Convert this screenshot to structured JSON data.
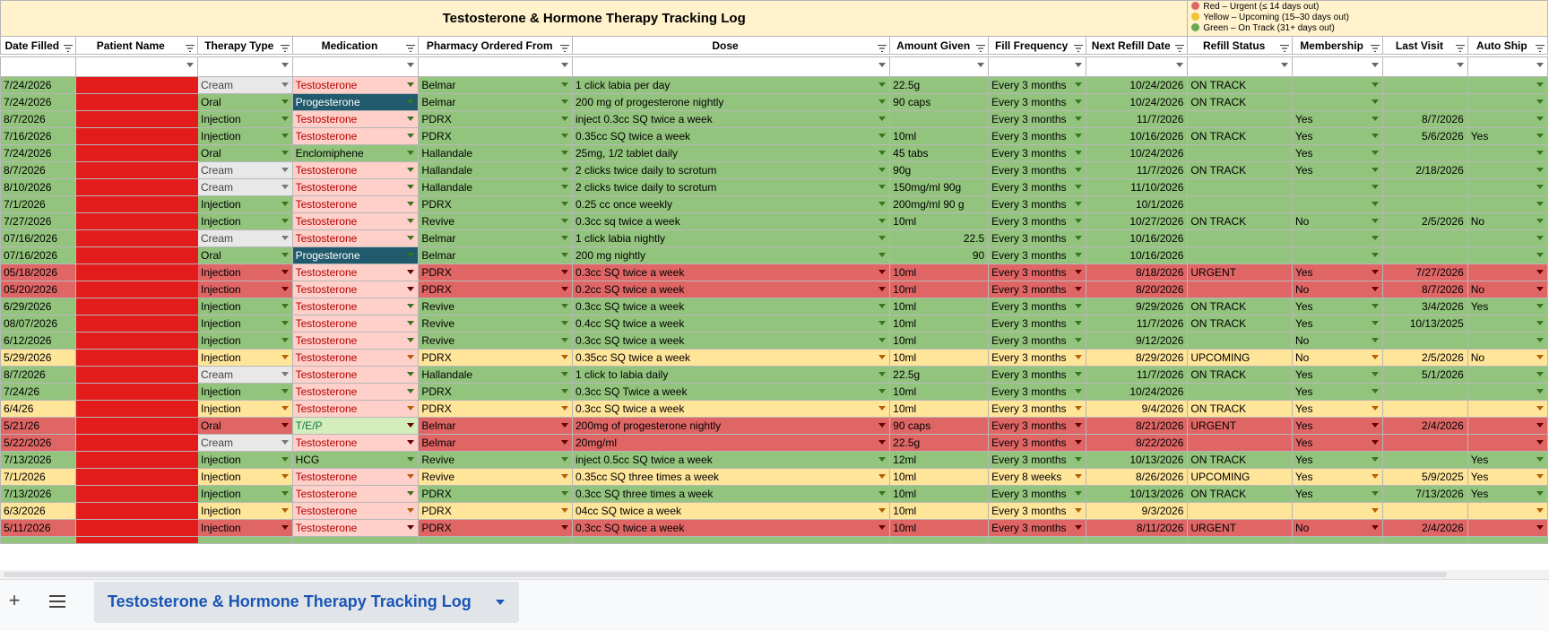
{
  "sheet_title": "Testosterone & Hormone Therapy Tracking Log",
  "legend": [
    {
      "label": "Red – Urgent (≤ 14 days out)",
      "color": "#e06666"
    },
    {
      "label": "Yellow – Upcoming (15–30 days out)",
      "color": "#f1c232"
    },
    {
      "label": "Green – On Track (31+ days out)",
      "color": "#6aa84f"
    }
  ],
  "colors": {
    "green": "#93c47d",
    "red": "#e06666",
    "yellow": "#ffe599",
    "header_bg": "#fff2cc",
    "tab_text": "#1a56b5"
  },
  "columns": [
    "Date Filled",
    "Patient Name",
    "Therapy Type",
    "Medication",
    "Pharmacy Ordered From",
    "Dose",
    "Amount Given",
    "Fill Frequency",
    "Next Refill Date",
    "Refill Status",
    "Membership",
    "Last Visit",
    "Auto Ship"
  ],
  "rows": [
    {
      "color": "g",
      "date": "7/24/2026",
      "therapy": "Cream",
      "med": "Testosterone",
      "pharmacy": "Belmar",
      "dose": "1 click labia per day",
      "amount": "22.5g",
      "freq": "Every 3 months",
      "next": "10/24/2026",
      "status": "ON TRACK",
      "membership": "",
      "last": "",
      "auto": ""
    },
    {
      "color": "g",
      "date": "7/24/2026",
      "therapy": "Oral",
      "med": "Progesterone",
      "pharmacy": "Belmar",
      "dose": "200 mg of progesterone nightly",
      "amount": "90 caps",
      "freq": "Every 3 months",
      "next": "10/24/2026",
      "status": "ON TRACK",
      "membership": "",
      "last": "",
      "auto": ""
    },
    {
      "color": "g",
      "date": "8/7/2026",
      "therapy": "Injection",
      "med": "Testosterone",
      "pharmacy": "PDRX",
      "dose": "inject 0.3cc SQ twice a week",
      "amount": "",
      "freq": "Every 3 months",
      "next": "11/7/2026",
      "status": "",
      "membership": "Yes",
      "last": "8/7/2026",
      "auto": ""
    },
    {
      "color": "g",
      "date": "7/16/2026",
      "therapy": "Injection",
      "med": "Testosterone",
      "pharmacy": "PDRX",
      "dose": "0.35cc SQ twice a week",
      "amount": "10ml",
      "freq": "Every 3 months",
      "next": "10/16/2026",
      "status": "ON TRACK",
      "membership": "Yes",
      "last": "5/6/2026",
      "auto": "Yes"
    },
    {
      "color": "g",
      "date": "7/24/2026",
      "therapy": "Oral",
      "med": "Enclomiphene",
      "pharmacy": "Hallandale",
      "dose": "25mg, 1/2 tablet daily",
      "amount": "45 tabs",
      "freq": "Every 3 months",
      "next": "10/24/2026",
      "status": "",
      "membership": "Yes",
      "last": "",
      "auto": ""
    },
    {
      "color": "g",
      "date": "8/7/2026",
      "therapy": "Cream",
      "med": "Testosterone",
      "pharmacy": "Hallandale",
      "dose": "2 clicks twice daily to scrotum",
      "amount": "90g",
      "freq": "Every 3 months",
      "next": "11/7/2026",
      "status": "ON TRACK",
      "membership": "Yes",
      "last": "2/18/2026",
      "auto": ""
    },
    {
      "color": "g",
      "date": "8/10/2026",
      "therapy": "Cream",
      "med": "Testosterone",
      "pharmacy": "Hallandale",
      "dose": "2 clicks twice daily to scrotum",
      "amount": "150mg/ml 90g",
      "freq": "Every 3 months",
      "next": "11/10/2026",
      "status": "",
      "membership": "",
      "last": "",
      "auto": ""
    },
    {
      "color": "g",
      "date": "7/1/2026",
      "therapy": "Injection",
      "med": "Testosterone",
      "pharmacy": "PDRX",
      "dose": "0.25 cc once weekly",
      "amount": "200mg/ml 90 g",
      "freq": "Every 3 months",
      "next": "10/1/2026",
      "status": "",
      "membership": "",
      "last": "",
      "auto": ""
    },
    {
      "color": "g",
      "date": "7/27/2026",
      "therapy": "Injection",
      "med": "Testosterone",
      "pharmacy": "Revive",
      "dose": "0.3cc sq twice a week",
      "amount": "10ml",
      "freq": "Every 3 months",
      "next": "10/27/2026",
      "status": "ON TRACK",
      "membership": "No",
      "last": "2/5/2026",
      "auto": "No"
    },
    {
      "color": "g",
      "date": "07/16/2026",
      "therapy": "Cream",
      "med": "Testosterone",
      "pharmacy": "Belmar",
      "dose": "1 click labia nightly",
      "amount": "22.5",
      "amount_num": true,
      "freq": "Every 3 months",
      "next": "10/16/2026",
      "status": "",
      "membership": "",
      "last": "",
      "auto": ""
    },
    {
      "color": "g",
      "date": "07/16/2026",
      "therapy": "Oral",
      "med": "Progesterone",
      "pharmacy": "Belmar",
      "dose": "200 mg nightly",
      "amount": "90",
      "amount_num": true,
      "freq": "Every 3 months",
      "next": "10/16/2026",
      "status": "",
      "membership": "",
      "last": "",
      "auto": ""
    },
    {
      "color": "r",
      "date": "05/18/2026",
      "therapy": "Injection",
      "med": "Testosterone",
      "pharmacy": "PDRX",
      "dose": "0.3cc SQ twice a week",
      "amount": "10ml",
      "freq": "Every 3 months",
      "next": "8/18/2026",
      "status": "URGENT",
      "membership": "Yes",
      "last": "7/27/2026",
      "auto": ""
    },
    {
      "color": "r",
      "date": "05/20/2026",
      "therapy": "Injection",
      "med": "Testosterone",
      "pharmacy": "PDRX",
      "dose": "0.2cc SQ twice a week",
      "amount": "10ml",
      "freq": "Every 3 months",
      "next": "8/20/2026",
      "status": "",
      "membership": "No",
      "last": "8/7/2026",
      "auto": "No"
    },
    {
      "color": "g",
      "date": "6/29/2026",
      "therapy": "Injection",
      "med": "Testosterone",
      "pharmacy": "Revive",
      "dose": "0.3cc SQ twice a week",
      "amount": "10ml",
      "freq": "Every 3 months",
      "next": "9/29/2026",
      "status": "ON TRACK",
      "membership": "Yes",
      "last": "3/4/2026",
      "auto": "Yes"
    },
    {
      "color": "g",
      "date": "08/07/2026",
      "therapy": "Injection",
      "med": "Testosterone",
      "pharmacy": "Revive",
      "dose": "0.4cc SQ twice a week",
      "amount": "10ml",
      "freq": "Every 3 months",
      "next": "11/7/2026",
      "status": "ON TRACK",
      "membership": "Yes",
      "last": "10/13/2025",
      "auto": ""
    },
    {
      "color": "g",
      "date": "6/12/2026",
      "therapy": "Injection",
      "med": "Testosterone",
      "pharmacy": "Revive",
      "dose": " 0.3cc SQ twice a week",
      "amount": "10ml",
      "freq": "Every 3 months",
      "next": "9/12/2026",
      "status": "",
      "membership": "No",
      "last": "",
      "auto": ""
    },
    {
      "color": "y",
      "date": "5/29/2026",
      "therapy": "Injection",
      "med": "Testosterone",
      "pharmacy": "PDRX",
      "dose": "0.35cc SQ twice a week",
      "amount": "10ml",
      "freq": "Every 3 months",
      "next": "8/29/2026",
      "status": "UPCOMING",
      "membership": "No",
      "last": "2/5/2026",
      "auto": "No"
    },
    {
      "color": "g",
      "date": "8/7/2026",
      "therapy": "Cream",
      "med": "Testosterone",
      "pharmacy": "Hallandale",
      "dose": "1 click to labia daily",
      "amount": "22.5g",
      "freq": "Every 3 months",
      "next": "11/7/2026",
      "status": "ON TRACK",
      "membership": "Yes",
      "last": "5/1/2026",
      "auto": ""
    },
    {
      "color": "g",
      "date": "7/24/26",
      "therapy": "Injection",
      "med": "Testosterone",
      "pharmacy": "PDRX",
      "dose": "0.3cc SQ Twice a week",
      "amount": "10ml",
      "freq": "Every 3 months",
      "next": "10/24/2026",
      "status": "",
      "membership": "Yes",
      "last": "",
      "auto": ""
    },
    {
      "color": "y",
      "date": "6/4/26",
      "therapy": "Injection",
      "med": "Testosterone",
      "pharmacy": "PDRX",
      "dose": "0.3cc SQ twice a week",
      "amount": "10ml",
      "freq": "Every 3 months",
      "next": "9/4/2026",
      "status": "ON TRACK",
      "membership": "Yes",
      "last": "",
      "auto": ""
    },
    {
      "color": "r",
      "date": "5/21/26",
      "therapy": "Oral",
      "med": "T/E/P",
      "pharmacy": "Belmar",
      "dose": "200mg of progesterone nightly",
      "amount": "90 caps",
      "freq": "Every 3 months",
      "next": "8/21/2026",
      "status": "URGENT",
      "membership": "Yes",
      "last": "2/4/2026",
      "auto": ""
    },
    {
      "color": "r",
      "date": "5/22/2026",
      "therapy": "Cream",
      "med": "Testosterone",
      "pharmacy": "Belmar",
      "dose": "20mg/ml",
      "amount": "22.5g",
      "freq": "Every 3 months",
      "next": "8/22/2026",
      "status": "",
      "membership": "Yes",
      "last": "",
      "auto": ""
    },
    {
      "color": "g",
      "date": "7/13/2026",
      "therapy": "Injection",
      "med": "HCG",
      "pharmacy": "Revive",
      "dose": "inject 0.5cc SQ twice a week",
      "amount": "12ml",
      "freq": "Every 3 months",
      "next": "10/13/2026",
      "status": "ON TRACK",
      "membership": "Yes",
      "last": "",
      "auto": "Yes"
    },
    {
      "color": "y",
      "date": "7/1/2026",
      "therapy": "Injection",
      "med": "Testosterone",
      "pharmacy": "Revive",
      "dose": "0.35cc SQ three times a week",
      "amount": "10ml",
      "freq": "Every 8 weeks",
      "next": "8/26/2026",
      "status": "UPCOMING",
      "membership": "Yes",
      "last": "5/9/2025",
      "auto": "Yes"
    },
    {
      "color": "g",
      "date": "7/13/2026",
      "therapy": "Injection",
      "med": "Testosterone",
      "pharmacy": "PDRX",
      "dose": "0.3cc SQ three times a week",
      "amount": "10ml",
      "freq": "Every 3 months",
      "next": "10/13/2026",
      "status": "ON TRACK",
      "membership": "Yes",
      "last": "7/13/2026",
      "auto": "Yes"
    },
    {
      "color": "y",
      "date": "6/3/2026",
      "therapy": "Injection",
      "med": "Testosterone",
      "pharmacy": "PDRX",
      "dose": "04cc SQ twice a week",
      "amount": "10ml",
      "freq": "Every 3 months",
      "next": "9/3/2026",
      "status": "",
      "membership": "",
      "last": "",
      "auto": ""
    },
    {
      "color": "r",
      "date": "5/11/2026",
      "therapy": "Injection",
      "med": "Testosterone",
      "pharmacy": "PDRX",
      "dose": "0.3cc SQ twice a week",
      "amount": "10ml",
      "freq": "Every 3 months",
      "next": "8/11/2026",
      "status": "URGENT",
      "membership": "No",
      "last": "2/4/2026",
      "auto": ""
    }
  ],
  "sheet_tabs": [
    {
      "label": "Testosterone & Hormone Therapy Tracking Log",
      "active": true
    }
  ],
  "icons": {
    "add_sheet": "+",
    "all_sheets": "menu-icon",
    "tab_menu": "caret-down-icon",
    "filter": "filter-icon"
  }
}
